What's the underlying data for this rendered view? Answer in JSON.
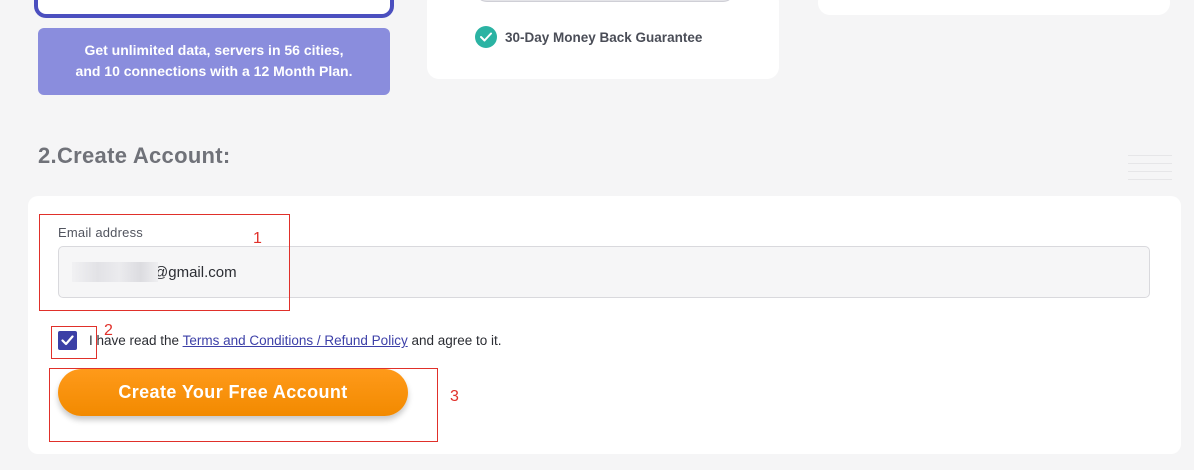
{
  "promo": {
    "line1": "Get unlimited data, servers in 56 cities,",
    "line2": "and 10 connections with a 12 Month Plan."
  },
  "guarantee": {
    "text": "30-Day Money Back Guarantee"
  },
  "section": {
    "title": "2.Create Account:"
  },
  "form": {
    "email_label": "Email address",
    "email_value": "@gmail.com",
    "agree_prefix": "I have read the ",
    "agree_link": "Terms and Conditions / Refund Policy",
    "agree_suffix": " and agree to it.",
    "checkbox_checked": true,
    "submit_label": "Create Your Free Account"
  },
  "annotations": [
    {
      "label": "1"
    },
    {
      "label": "2"
    },
    {
      "label": "3"
    }
  ],
  "colors": {
    "accent_purple": "#3b3fa6",
    "promo_bg": "#8a8ddd",
    "cta_orange": "#f28a00",
    "annotation_red": "#e0302a",
    "badge_teal": "#2bb3a3"
  }
}
